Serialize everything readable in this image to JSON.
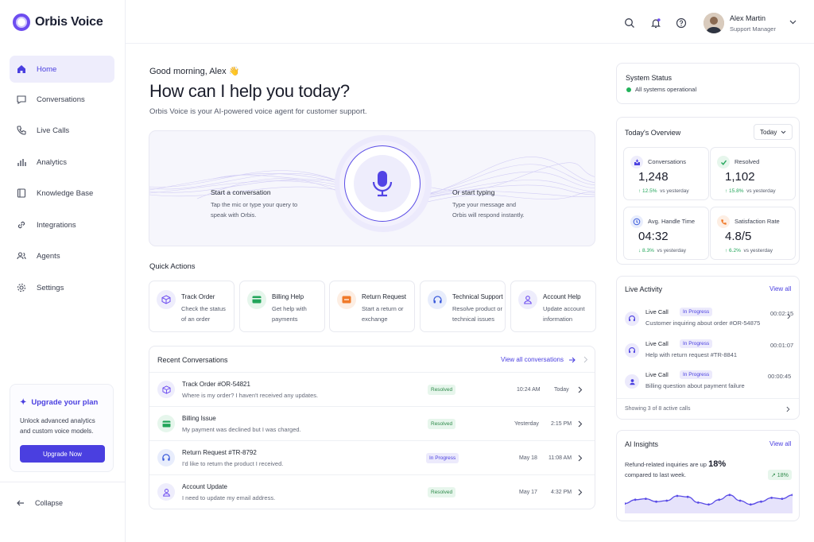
{
  "app": {
    "name": "Orbis Voice"
  },
  "sidebar": {
    "items": [
      {
        "label": "Home",
        "icon": "home-icon"
      },
      {
        "label": "Conversations",
        "icon": "chat-icon"
      },
      {
        "label": "Live Calls",
        "icon": "phone-icon"
      },
      {
        "label": "Analytics",
        "icon": "bar-chart-icon"
      },
      {
        "label": "Knowledge Base",
        "icon": "book-icon"
      },
      {
        "label": "Integrations",
        "icon": "link-icon"
      },
      {
        "label": "Agents",
        "icon": "users-icon"
      },
      {
        "label": "Settings",
        "icon": "gear-icon"
      }
    ],
    "upgrade": {
      "title": "Upgrade your plan",
      "description": "Unlock advanced analytics and custom voice models.",
      "button": "Upgrade Now"
    },
    "collapse": "Collapse"
  },
  "header": {
    "user_name": "Alex Martin",
    "user_role": "Support Manager"
  },
  "main": {
    "greeting": "Good morning, Alex 👋",
    "title": "How can I help you today?",
    "subtitle": "Orbis Voice is your AI-powered voice agent for customer support.",
    "hero": {
      "left_title": "Start a conversation",
      "left_desc": "Tap the mic or type your query to speak with Orbis.",
      "right_title": "Or start typing",
      "right_desc": "Type your message and Orbis will respond instantly."
    },
    "quick_actions_title": "Quick Actions",
    "quick_actions": [
      {
        "title": "Track Order",
        "desc": "Check the status of an order",
        "icon": "package-icon",
        "color": "#6d4df0",
        "bg": "#eeedfc"
      },
      {
        "title": "Billing Help",
        "desc": "Get help with payments",
        "icon": "card-icon",
        "color": "#22a55a",
        "bg": "#e6f6ec"
      },
      {
        "title": "Return Request",
        "desc": "Start a return or exchange",
        "icon": "return-icon",
        "color": "#f07a2a",
        "bg": "#fdeee3"
      },
      {
        "title": "Technical Support",
        "desc": "Resolve product or technical issues",
        "icon": "headset-icon",
        "color": "#3b5bdb",
        "bg": "#e8edfc"
      },
      {
        "title": "Account Help",
        "desc": "Update account information",
        "icon": "user-icon",
        "color": "#6d4df0",
        "bg": "#eeedfc"
      }
    ],
    "recent": {
      "title": "Recent Conversations",
      "view_all": "View all conversations",
      "rows": [
        {
          "title": "Track Order #OR-54821",
          "desc": "Where is my order? I haven't received any updates.",
          "status": "Resolved",
          "date": "10:24 AM",
          "time": "Today"
        },
        {
          "title": "Billing Issue",
          "desc": "My payment was declined but I was charged.",
          "status": "Resolved",
          "date": "Yesterday",
          "time": "2:15 PM"
        },
        {
          "title": "Return Request #TR-8792",
          "desc": "I'd like to return the product I received.",
          "status": "In Progress",
          "date": "May 18",
          "time": "11:08 AM"
        },
        {
          "title": "Account Update",
          "desc": "I need to update my email address.",
          "status": "Resolved",
          "date": "May 17",
          "time": "4:32 PM"
        }
      ]
    }
  },
  "right": {
    "system": {
      "title": "System Status",
      "status": "All systems operational"
    },
    "overview": {
      "title": "Today's Overview",
      "range": "Today",
      "stats": [
        {
          "label": "Conversations",
          "value": "1,248",
          "change": "↑ 12.5%",
          "suffix": "vs yesterday",
          "change_color": "#22a55a"
        },
        {
          "label": "Resolved",
          "value": "1,102",
          "change": "↑ 15.8%",
          "suffix": "vs yesterday",
          "change_color": "#22a55a"
        },
        {
          "label": "Avg. Handle Time",
          "value": "04:32",
          "change": "↓ 8.3%",
          "suffix": "vs yesterday",
          "change_color": "#22a55a"
        },
        {
          "label": "Satisfaction Rate",
          "value": "4.8/5",
          "change": "↑ 6.2%",
          "suffix": "vs yesterday",
          "change_color": "#22a55a"
        }
      ]
    },
    "live": {
      "title": "Live Activity",
      "view_all": "View all",
      "rows": [
        {
          "label": "Live Call",
          "status": "In Progress",
          "desc": "Customer inquiring about order #OR-54875",
          "time": "00:02:15"
        },
        {
          "label": "Live Call",
          "status": "In Progress",
          "desc": "Help with return request #TR-8841",
          "time": "00:01:07"
        },
        {
          "label": "Live Call",
          "status": "In Progress",
          "desc": "Billing question about payment failure",
          "time": "00:00:45"
        }
      ],
      "footer": "Showing 3 of 8 active calls"
    },
    "insights": {
      "title": "AI Insights",
      "view_all": "View all",
      "text": "Refund-related inquiries are up",
      "pct": "18%",
      "text2": "compared to last week.",
      "badge": "↗ 18%",
      "trend": [
        0.35,
        0.55,
        0.6,
        0.45,
        0.5,
        0.75,
        0.7,
        0.4,
        0.3,
        0.55,
        0.8,
        0.5,
        0.3,
        0.45,
        0.65,
        0.6,
        0.8
      ]
    }
  }
}
